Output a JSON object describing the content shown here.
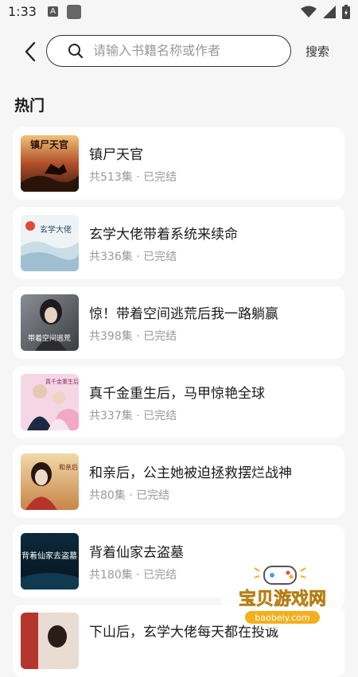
{
  "status_bar": {
    "time": "1:33",
    "a_badge": "A"
  },
  "header": {
    "search_placeholder": "请输入书籍名称或作者",
    "search_button": "搜索"
  },
  "section": {
    "title": "热门"
  },
  "books": [
    {
      "title": "镇尸天官",
      "episodes": "共513集",
      "status": "已完结",
      "cover_text": "镇尸天官"
    },
    {
      "title": "玄学大佬带着系统来续命",
      "episodes": "共336集",
      "status": "已完结",
      "cover_text": "玄学大佬"
    },
    {
      "title": "惊！带着空间逃荒后我一路躺赢",
      "episodes": "共398集",
      "status": "已完结",
      "cover_text": "带着空间逃荒"
    },
    {
      "title": "真千金重生后，马甲惊艳全球",
      "episodes": "共337集",
      "status": "已完结",
      "cover_text": "真千金重生后"
    },
    {
      "title": "和亲后，公主她被迫拯救摆烂战神",
      "episodes": "共80集",
      "status": "已完结",
      "cover_text": "和亲后"
    },
    {
      "title": "背着仙家去盗墓",
      "episodes": "共180集",
      "status": "已完结",
      "cover_text": "背着仙家去盗墓"
    },
    {
      "title": "下山后，玄学大佬每天都在投诚",
      "episodes": "",
      "status": "",
      "cover_text": ""
    }
  ],
  "watermark": {
    "title": "宝贝游戏网",
    "url": "baobeiy.com"
  },
  "colors": {
    "background": "#f6f6f6",
    "card": "#ffffff",
    "meta_text": "#999999",
    "watermark": "#f2b01e"
  }
}
